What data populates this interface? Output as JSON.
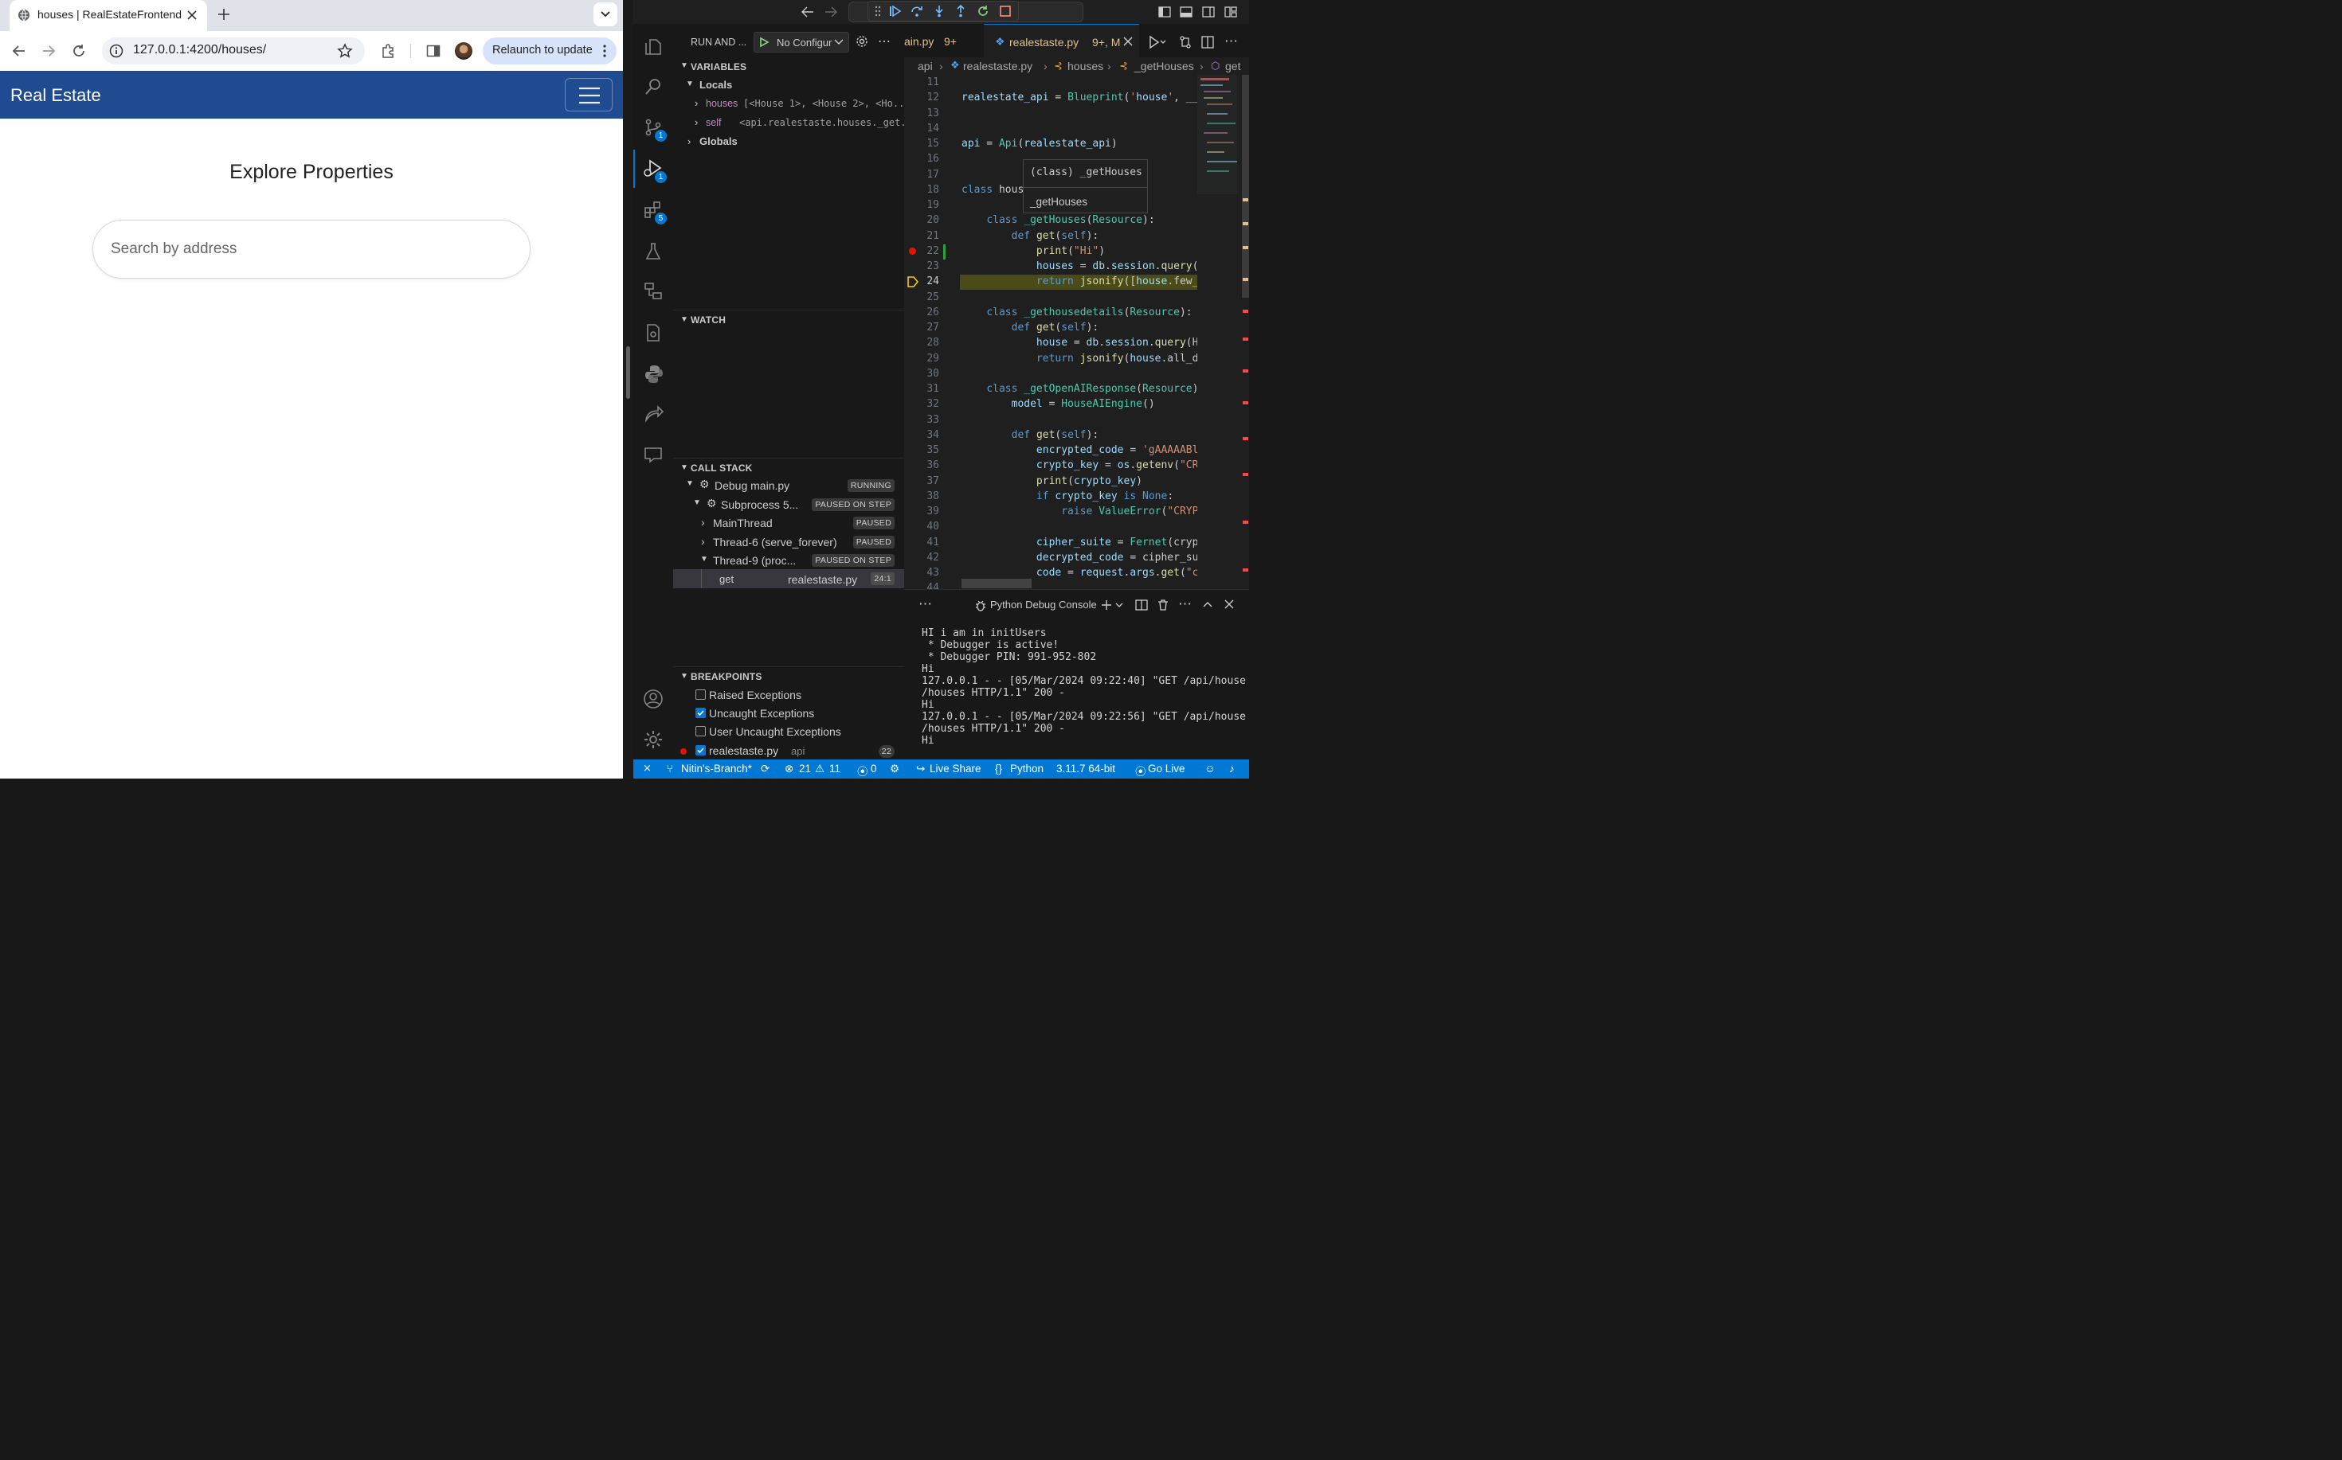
{
  "browser": {
    "tab_title": "houses | RealEstateFrontend",
    "url": "127.0.0.1:4200/houses/",
    "relaunch_label": "Relaunch to update"
  },
  "site": {
    "brand": "Real Estate",
    "heading": "Explore Properties",
    "search_placeholder": "Search by address"
  },
  "vscode": {
    "activity_badges": {
      "source_control": "1",
      "run_debug": "1",
      "extensions": "5"
    },
    "sidebar": {
      "title": "RUN AND ...",
      "config": "No Configur",
      "variables_header": "VARIABLES",
      "locals_label": "Locals",
      "locals": [
        {
          "name": "houses",
          "value": "[<House 1>, <House 2>, <Ho..."
        },
        {
          "name": "self",
          "value": "<api.realestaste.houses._get..."
        }
      ],
      "globals_label": "Globals",
      "watch_header": "WATCH",
      "callstack_header": "CALL STACK",
      "callstack": [
        {
          "label": "Debug main.py",
          "status": "RUNNING"
        },
        {
          "label": "Subprocess 5...",
          "status": "PAUSED ON STEP"
        },
        {
          "label": "MainThread",
          "status": "PAUSED"
        },
        {
          "label": "Thread-6 (serve_forever)",
          "status": "PAUSED"
        },
        {
          "label": "Thread-9 (proc...",
          "status": "PAUSED ON STEP"
        }
      ],
      "frame": {
        "fn": "get",
        "file": "realestaste.py",
        "pos": "24:1"
      },
      "breakpoints_header": "BREAKPOINTS",
      "breakpoints": [
        {
          "label": "Raised Exceptions",
          "checked": false
        },
        {
          "label": "Uncaught Exceptions",
          "checked": true
        },
        {
          "label": "User Uncaught Exceptions",
          "checked": false
        }
      ],
      "bp_file": {
        "label": "realestaste.py",
        "folder": "api",
        "line": "22"
      }
    },
    "tabs": [
      {
        "label": "ain.py",
        "status": "9+"
      },
      {
        "label": "realestaste.py",
        "status": "9+, M"
      }
    ],
    "breadcrumb": [
      "api",
      "realestaste.py",
      "houses",
      "_getHouses",
      "get"
    ],
    "code_lines": [
      {
        "n": "11",
        "t": ""
      },
      {
        "n": "12",
        "t": "realestate_api = Blueprint('house', __n"
      },
      {
        "n": "13",
        "t": ""
      },
      {
        "n": "14",
        "t": ""
      },
      {
        "n": "15",
        "t": "api = Api(realestate_api)"
      },
      {
        "n": "16",
        "t": ""
      },
      {
        "n": "17",
        "t": ""
      },
      {
        "n": "18",
        "t": "class hous"
      },
      {
        "n": "19",
        "t": ""
      },
      {
        "n": "20",
        "t": "    class _getHouses(Resource):"
      },
      {
        "n": "21",
        "t": "        def get(self):"
      },
      {
        "n": "22",
        "t": "            print(\"Hi\")"
      },
      {
        "n": "23",
        "t": "            houses = db.session.query(H"
      },
      {
        "n": "24",
        "t": "            return jsonify([house.few_d"
      },
      {
        "n": "25",
        "t": ""
      },
      {
        "n": "26",
        "t": "    class _gethousedetails(Resource):"
      },
      {
        "n": "27",
        "t": "        def get(self):"
      },
      {
        "n": "28",
        "t": "            house = db.session.query(Ho"
      },
      {
        "n": "29",
        "t": "            return jsonify(house.all_de"
      },
      {
        "n": "30",
        "t": ""
      },
      {
        "n": "31",
        "t": "    class _getOpenAIResponse(Resource):"
      },
      {
        "n": "32",
        "t": "        model = HouseAIEngine()"
      },
      {
        "n": "33",
        "t": ""
      },
      {
        "n": "34",
        "t": "        def get(self):"
      },
      {
        "n": "35",
        "t": "            encrypted_code = 'gAAAAABl("
      },
      {
        "n": "36",
        "t": "            crypto_key = os.getenv(\"CRY"
      },
      {
        "n": "37",
        "t": "            print(crypto_key)"
      },
      {
        "n": "38",
        "t": "            if crypto_key is None:"
      },
      {
        "n": "39",
        "t": "                raise ValueError(\"CRYPT"
      },
      {
        "n": "40",
        "t": ""
      },
      {
        "n": "41",
        "t": "            cipher_suite = Fernet(crypt"
      },
      {
        "n": "42",
        "t": "            decrypted_code = cipher_sui"
      },
      {
        "n": "43",
        "t": "            code = request.args.get(\"co"
      },
      {
        "n": "44",
        "t": ""
      }
    ],
    "hover": {
      "line1": "(class) _getHouses",
      "line2": "_getHouses"
    },
    "panel": {
      "title": "Python Debug Console",
      "output": [
        "HI i am in initUsers",
        " * Debugger is active!",
        " * Debugger PIN: 991-952-802",
        "Hi",
        "127.0.0.1 - - [05/Mar/2024 09:22:40] \"GET /api/house",
        "/houses HTTP/1.1\" 200 -",
        "Hi",
        "127.0.0.1 - - [05/Mar/2024 09:22:56] \"GET /api/house",
        "/houses HTTP/1.1\" 200 -",
        "Hi"
      ]
    },
    "status": {
      "branch": "Nitin's-Branch*",
      "errors": "21",
      "warnings": "11",
      "ports": "0",
      "live_share": "Live Share",
      "language": "Python",
      "interpreter": "3.11.7 64-bit",
      "go_live": "Go Live"
    }
  }
}
